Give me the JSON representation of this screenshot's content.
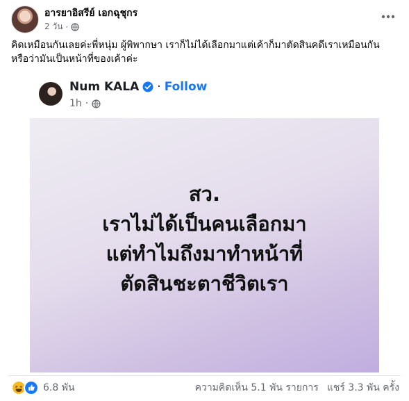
{
  "post": {
    "author": "อารยาอิสรีย์ เอกฉุชุกร",
    "time": "2 วัน",
    "time_sep": "·",
    "caption_lines": [
      "คิดเหมือนกันเลยค่ะพี่หนุ่ม  ผู้พิพากษา เราก็ไม่ได้เลือกมาแต่เค้าก็มาตัดสินคดีเราเหมือนกัน",
      "หรือว่ามันเป็นหน้าที่ของเค้าค่ะ"
    ]
  },
  "embedded": {
    "name": "Num KALA",
    "separator": "·",
    "follow": "Follow",
    "time": "1h",
    "time_sep": "·",
    "quote_lines": [
      "สว.",
      "เราไม่ได้เป็นคนเลือกมา",
      "แต่ทำไมถึงมาทำหน้าที่",
      "ตัดสินชะตาชีวิตเรา"
    ]
  },
  "footer": {
    "reaction_count": "6.8 พัน",
    "comments": "ความคิดเห็น 5.1 พัน รายการ",
    "shares": "แชร์ 3.3 พัน ครั้ง"
  },
  "icons": {
    "more": "more-horizontal-icon",
    "globe": "globe-icon",
    "verified": "verified-badge-icon",
    "reactions": [
      "haha-reaction-icon",
      "like-reaction-icon"
    ]
  },
  "colors": {
    "link_blue": "#1877f2",
    "secondary_text": "#65676b",
    "quote_gradient_end": "#c0ade0"
  }
}
